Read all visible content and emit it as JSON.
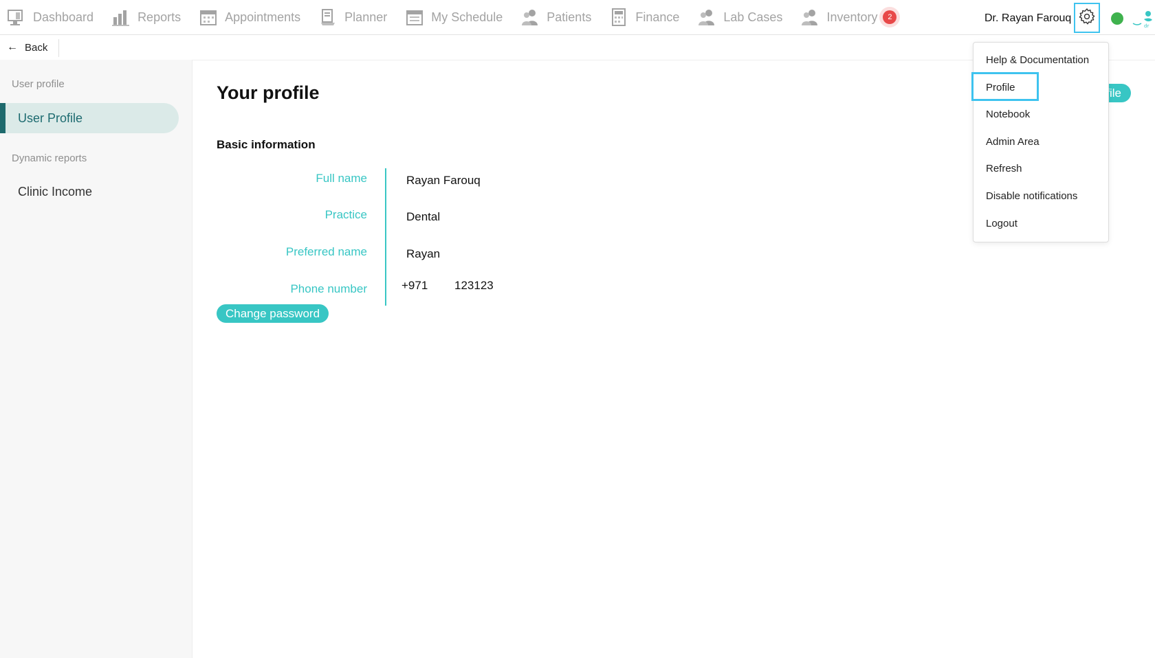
{
  "nav": {
    "items": [
      {
        "label": "Dashboard",
        "icon": "dashboard-icon"
      },
      {
        "label": "Reports",
        "icon": "reports-icon"
      },
      {
        "label": "Appointments",
        "icon": "appointments-icon"
      },
      {
        "label": "Planner",
        "icon": "planner-icon"
      },
      {
        "label": "My Schedule",
        "icon": "schedule-icon"
      },
      {
        "label": "Patients",
        "icon": "patients-icon"
      },
      {
        "label": "Finance",
        "icon": "finance-icon"
      },
      {
        "label": "Lab Cases",
        "icon": "lab-cases-icon"
      },
      {
        "label": "Inventory",
        "icon": "inventory-icon"
      }
    ],
    "badge_count": "2",
    "user_name": "Dr. Rayan Farouq",
    "status_color": "#3fb24e"
  },
  "back": {
    "label": "Back"
  },
  "sidebar": {
    "section1_header": "User profile",
    "section1_item": "User Profile",
    "section2_header": "Dynamic reports",
    "section2_item": "Clinic Income"
  },
  "main": {
    "title": "Your profile",
    "section_title": "Basic information",
    "fields": [
      {
        "label": "Full name",
        "value": "Rayan Farouq"
      },
      {
        "label": "Practice",
        "value": "Dental"
      },
      {
        "label": "Preferred name",
        "value": "Rayan"
      },
      {
        "label": "Phone number",
        "code": "+971",
        "number": "123123"
      }
    ],
    "change_password": "Change password",
    "edit_profile_partial": "file"
  },
  "dropdown": {
    "items": [
      "Help & Documentation",
      "Profile",
      "Notebook",
      "Admin Area",
      "Refresh",
      "Disable notifications",
      "Logout"
    ],
    "highlighted": "Profile"
  },
  "colors": {
    "accent": "#38c6c4",
    "highlight": "#3ec3ef",
    "badge": "#e84848",
    "active_bg": "#dbeae8"
  }
}
